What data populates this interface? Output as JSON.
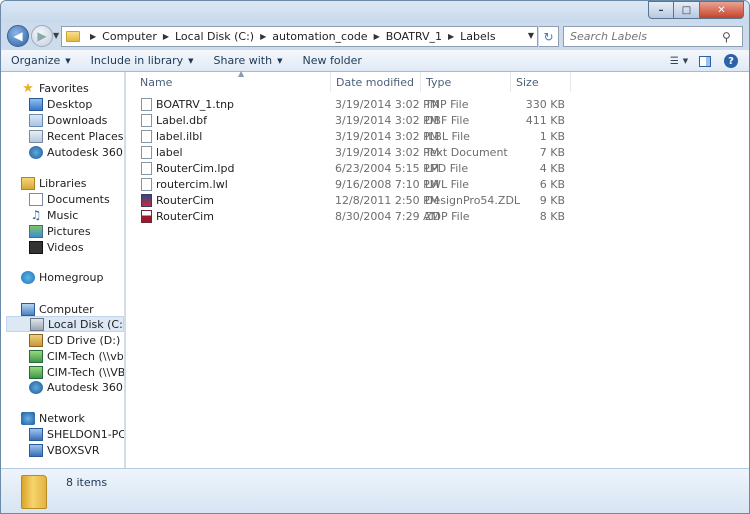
{
  "window": {
    "minimize_glyph": "–",
    "maximize_glyph": "□",
    "close_glyph": "✕"
  },
  "address": {
    "crumbs": [
      "Computer",
      "Local Disk (C:)",
      "automation_code",
      "BOATRV_1",
      "Labels"
    ],
    "separator_glyph": "▶",
    "search_placeholder": "Search Labels"
  },
  "toolbar": {
    "organize": "Organize",
    "include_in_library": "Include in library",
    "share_with": "Share with",
    "new_folder": "New folder"
  },
  "nav": {
    "favorites": {
      "label": "Favorites",
      "items": [
        "Desktop",
        "Downloads",
        "Recent Places",
        "Autodesk 360"
      ]
    },
    "libraries": {
      "label": "Libraries",
      "items": [
        "Documents",
        "Music",
        "Pictures",
        "Videos"
      ]
    },
    "homegroup": {
      "label": "Homegroup"
    },
    "computer": {
      "label": "Computer",
      "items": [
        "Local Disk (C:)",
        "CD Drive (D:) Virtual",
        "CIM-Tech (\\\\vboxsr",
        "CIM-Tech (\\\\VBOXS",
        "Autodesk 360"
      ],
      "selected_index": 0
    },
    "network": {
      "label": "Network",
      "items": [
        "SHELDON1-PC",
        "VBOXSVR"
      ]
    }
  },
  "columns": {
    "name": "Name",
    "date": "Date modified",
    "type": "Type",
    "size": "Size"
  },
  "files": [
    {
      "name": "BOATRV_1.tnp",
      "date": "3/19/2014 3:02 PM",
      "type": "TNP File",
      "size": "330 KB",
      "icon": "generic-file-icon"
    },
    {
      "name": "Label.dbf",
      "date": "3/19/2014 3:02 PM",
      "type": "DBF File",
      "size": "411 KB",
      "icon": "generic-file-icon"
    },
    {
      "name": "label.ilbl",
      "date": "3/19/2014 3:02 PM",
      "type": "ILBL File",
      "size": "1 KB",
      "icon": "generic-file-icon"
    },
    {
      "name": "label",
      "date": "3/19/2014 3:02 PM",
      "type": "Text Document",
      "size": "7 KB",
      "icon": "text-file-icon"
    },
    {
      "name": "RouterCim.lpd",
      "date": "6/23/2004 5:15 PM",
      "type": "LPD File",
      "size": "4 KB",
      "icon": "generic-file-icon"
    },
    {
      "name": "routercim.lwl",
      "date": "9/16/2008 7:10 PM",
      "type": "LWL File",
      "size": "6 KB",
      "icon": "generic-file-icon"
    },
    {
      "name": "RouterCim",
      "date": "12/8/2011 2:50 PM",
      "type": "DesignPro54.ZDL",
      "size": "9 KB",
      "icon": "designpro-file-icon"
    },
    {
      "name": "RouterCim",
      "date": "8/30/2004 7:29 AM",
      "type": "ZDP File",
      "size": "8 KB",
      "icon": "zdp-file-icon"
    }
  ],
  "details": {
    "items_count": "8 items"
  }
}
